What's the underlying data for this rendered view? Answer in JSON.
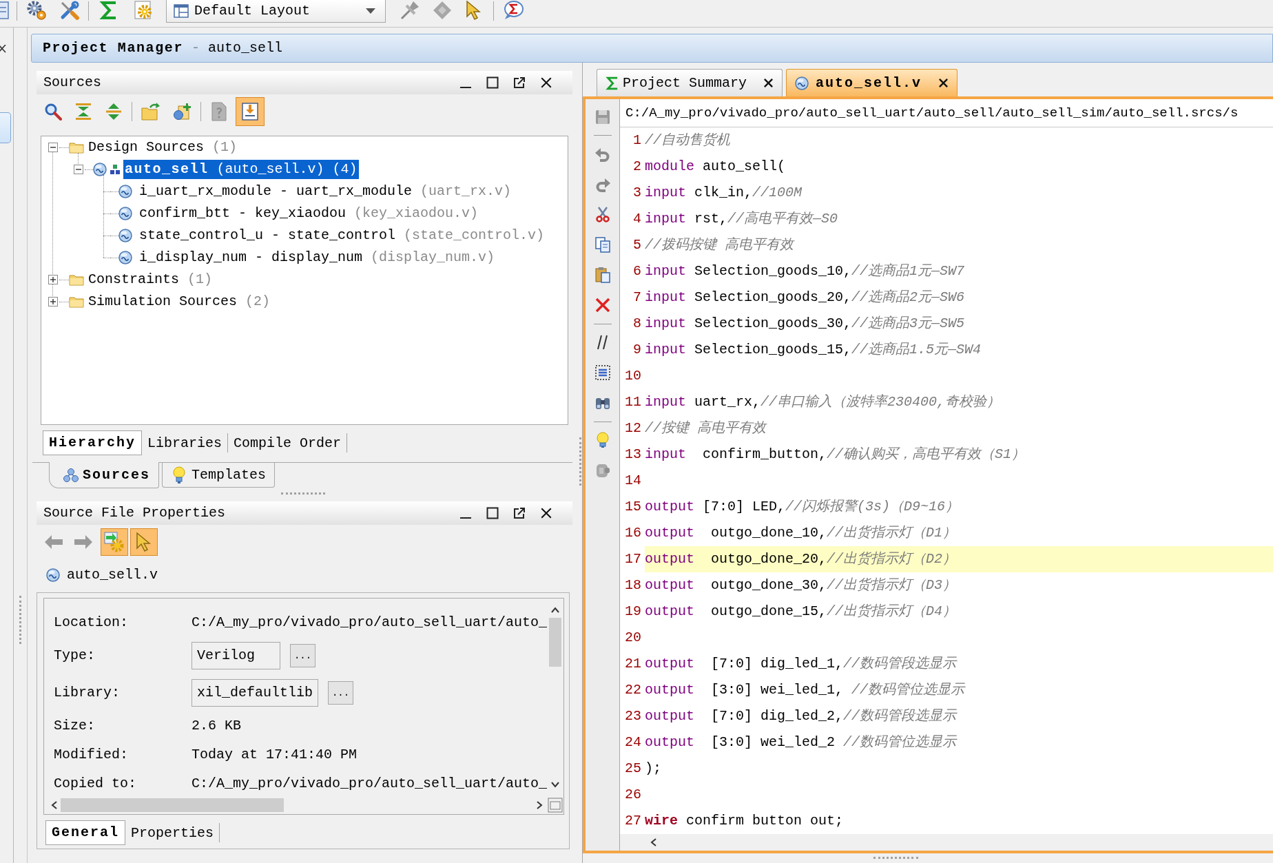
{
  "toolbar": {
    "layout": "Default Layout"
  },
  "header": {
    "title": "Project Manager",
    "separator": "-",
    "project": "auto_sell"
  },
  "sources": {
    "title": "Sources",
    "tree": [
      {
        "label": "Design Sources",
        "count": "(1)",
        "kind": "folder",
        "expanded": true,
        "selected": false,
        "children": [
          {
            "label": "auto_sell",
            "file": "(auto_sell.v)",
            "count": "(4)",
            "kind": "top",
            "expanded": true,
            "selected": true,
            "children": [
              {
                "label": "i_uart_rx_module - uart_rx_module",
                "file": "(uart_rx.v)",
                "kind": "module",
                "selected": false
              },
              {
                "label": "confirm_btt - key_xiaodou",
                "file": "(key_xiaodou.v)",
                "kind": "module",
                "selected": false
              },
              {
                "label": "state_control_u - state_control",
                "file": "(state_control.v)",
                "kind": "module",
                "selected": false
              },
              {
                "label": "i_display_num - display_num",
                "file": "(display_num.v)",
                "kind": "module",
                "selected": false
              }
            ]
          }
        ]
      },
      {
        "label": "Constraints",
        "count": "(1)",
        "kind": "folder",
        "expanded": false,
        "selected": false
      },
      {
        "label": "Simulation Sources",
        "count": "(2)",
        "kind": "folder",
        "expanded": false,
        "selected": false
      }
    ],
    "view_tabs": [
      {
        "label": "Hierarchy",
        "selected": true
      },
      {
        "label": "Libraries",
        "selected": false
      },
      {
        "label": "Compile Order",
        "selected": false
      }
    ]
  },
  "navigator_tabs": [
    {
      "label": "Sources",
      "kind": "sources",
      "selected": true
    },
    {
      "label": "Templates",
      "kind": "templates",
      "selected": false
    }
  ],
  "properties": {
    "title": "Source File Properties",
    "file": "auto_sell.v",
    "fields": [
      {
        "label": "Location:",
        "value": "C:/A_my_pro/vivado_pro/auto_sell_uart/auto_",
        "kind": "text"
      },
      {
        "label": "Type:",
        "value": "Verilog",
        "kind": "picker",
        "browse": "..."
      },
      {
        "label": "Library:",
        "value": "xil_defaultlib",
        "kind": "picker",
        "browse": "..."
      },
      {
        "label": "Size:",
        "value": "2.6 KB",
        "kind": "text"
      },
      {
        "label": "Modified:",
        "value": "Today at 17:41:40 PM",
        "kind": "text"
      },
      {
        "label": "Copied to:",
        "value": "C:/A_my_pro/vivado_pro/auto_sell_uart/auto_",
        "kind": "text"
      }
    ],
    "tabs": [
      {
        "label": "General",
        "selected": true
      },
      {
        "label": "Properties",
        "selected": false
      }
    ]
  },
  "editor": {
    "tabs": [
      {
        "label": "Project Summary",
        "kind": "summary",
        "selected": false
      },
      {
        "label": "auto_sell.v",
        "kind": "source",
        "selected": true
      }
    ],
    "path": "C:/A_my_pro/vivado_pro/auto_sell_uart/auto_sell/auto_sell_sim/auto_sell.srcs/s",
    "lines": [
      {
        "number": "1",
        "current": false,
        "tokens": [
          {
            "kind": "comment",
            "text": "//自动售货机"
          }
        ]
      },
      {
        "number": "2",
        "current": false,
        "tokens": [
          {
            "kind": "keyword",
            "text": "module"
          },
          {
            "kind": "plain",
            "text": " auto_sell("
          }
        ]
      },
      {
        "number": "3",
        "current": false,
        "tokens": [
          {
            "kind": "keyword",
            "text": "input"
          },
          {
            "kind": "plain",
            "text": " clk_in,"
          },
          {
            "kind": "comment",
            "text": "//100M"
          }
        ]
      },
      {
        "number": "4",
        "current": false,
        "tokens": [
          {
            "kind": "keyword",
            "text": "input"
          },
          {
            "kind": "plain",
            "text": " rst,"
          },
          {
            "kind": "comment",
            "text": "//高电平有效—S0"
          }
        ]
      },
      {
        "number": "5",
        "current": false,
        "tokens": [
          {
            "kind": "comment",
            "text": "//拨码按键 高电平有效"
          }
        ]
      },
      {
        "number": "6",
        "current": false,
        "tokens": [
          {
            "kind": "keyword",
            "text": "input"
          },
          {
            "kind": "plain",
            "text": " Selection_goods_10,"
          },
          {
            "kind": "comment",
            "text": "//选商品1元—SW7"
          }
        ]
      },
      {
        "number": "7",
        "current": false,
        "tokens": [
          {
            "kind": "keyword",
            "text": "input"
          },
          {
            "kind": "plain",
            "text": " Selection_goods_20,"
          },
          {
            "kind": "comment",
            "text": "//选商品2元—SW6"
          }
        ]
      },
      {
        "number": "8",
        "current": false,
        "tokens": [
          {
            "kind": "keyword",
            "text": "input"
          },
          {
            "kind": "plain",
            "text": " Selection_goods_30,"
          },
          {
            "kind": "comment",
            "text": "//选商品3元—SW5"
          }
        ]
      },
      {
        "number": "9",
        "current": false,
        "tokens": [
          {
            "kind": "keyword",
            "text": "input"
          },
          {
            "kind": "plain",
            "text": " Selection_goods_15,"
          },
          {
            "kind": "comment",
            "text": "//选商品1.5元—SW4"
          }
        ]
      },
      {
        "number": "10",
        "current": false
      },
      {
        "number": "11",
        "current": false,
        "tokens": [
          {
            "kind": "keyword",
            "text": "input"
          },
          {
            "kind": "plain",
            "text": " uart_rx,"
          },
          {
            "kind": "comment",
            "text": "//串口输入（波特率230400,奇校验）"
          }
        ]
      },
      {
        "number": "12",
        "current": false,
        "tokens": [
          {
            "kind": "comment",
            "text": "//按键 高电平有效"
          }
        ]
      },
      {
        "number": "13",
        "current": false,
        "tokens": [
          {
            "kind": "keyword",
            "text": "input"
          },
          {
            "kind": "plain",
            "text": "  confirm_button,"
          },
          {
            "kind": "comment",
            "text": "//确认购买，高电平有效（S1）"
          }
        ]
      },
      {
        "number": "14",
        "current": false
      },
      {
        "number": "15",
        "current": false,
        "tokens": [
          {
            "kind": "keyword",
            "text": "output"
          },
          {
            "kind": "plain",
            "text": " [7:0] LED,"
          },
          {
            "kind": "comment",
            "text": "//闪烁报警(3s)（D9~16）"
          }
        ]
      },
      {
        "number": "16",
        "current": false,
        "tokens": [
          {
            "kind": "keyword",
            "text": "output"
          },
          {
            "kind": "plain",
            "text": "  outgo_done_10,"
          },
          {
            "kind": "comment",
            "text": "//出货指示灯（D1）"
          }
        ]
      },
      {
        "number": "17",
        "current": true,
        "tokens": [
          {
            "kind": "keyword",
            "text": "output"
          },
          {
            "kind": "plain",
            "text": "  outgo_done_20,"
          },
          {
            "kind": "comment",
            "text": "//出货指示灯（D2）"
          }
        ]
      },
      {
        "number": "18",
        "current": false,
        "tokens": [
          {
            "kind": "keyword",
            "text": "output"
          },
          {
            "kind": "plain",
            "text": "  outgo_done_30,"
          },
          {
            "kind": "comment",
            "text": "//出货指示灯（D3）"
          }
        ]
      },
      {
        "number": "19",
        "current": false,
        "tokens": [
          {
            "kind": "keyword",
            "text": "output"
          },
          {
            "kind": "plain",
            "text": "  outgo_done_15,"
          },
          {
            "kind": "comment",
            "text": "//出货指示灯（D4）"
          }
        ]
      },
      {
        "number": "20",
        "current": false
      },
      {
        "number": "21",
        "current": false,
        "tokens": [
          {
            "kind": "keyword",
            "text": "output"
          },
          {
            "kind": "plain",
            "text": "  [7:0] dig_led_1,"
          },
          {
            "kind": "comment",
            "text": "//数码管段选显示"
          }
        ]
      },
      {
        "number": "22",
        "current": false,
        "tokens": [
          {
            "kind": "keyword",
            "text": "output"
          },
          {
            "kind": "plain",
            "text": "  [3:0] wei_led_1, "
          },
          {
            "kind": "comment",
            "text": "//数码管位选显示"
          }
        ]
      },
      {
        "number": "23",
        "current": false,
        "tokens": [
          {
            "kind": "keyword",
            "text": "output"
          },
          {
            "kind": "plain",
            "text": "  [7:0] dig_led_2,"
          },
          {
            "kind": "comment",
            "text": "//数码管段选显示"
          }
        ]
      },
      {
        "number": "24",
        "current": false,
        "tokens": [
          {
            "kind": "keyword",
            "text": "output"
          },
          {
            "kind": "plain",
            "text": "  [3:0] wei_led_2 "
          },
          {
            "kind": "comment",
            "text": "//数码管位选显示"
          }
        ]
      },
      {
        "number": "25",
        "current": false,
        "tokens": [
          {
            "kind": "plain",
            "text": ");"
          }
        ]
      },
      {
        "number": "26",
        "current": false
      },
      {
        "number": "27",
        "current": false,
        "tokens": [
          {
            "kind": "type",
            "text": "wire"
          },
          {
            "kind": "plain",
            "text": " confirm button out;"
          }
        ]
      }
    ]
  }
}
